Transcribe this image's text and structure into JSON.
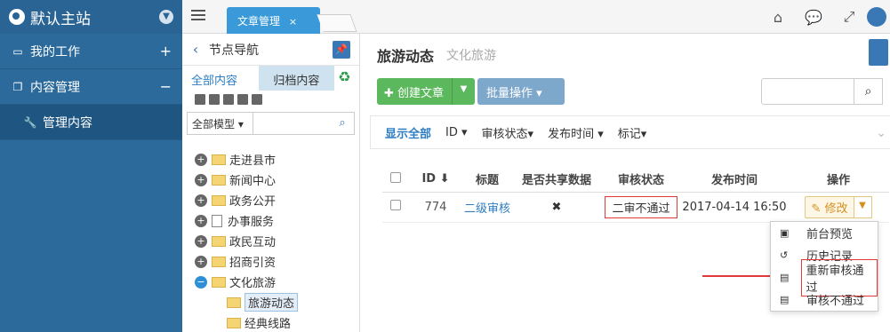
{
  "sidebar": {
    "brand": "默认主站",
    "items": [
      {
        "label": "我的工作",
        "toggle": "+"
      },
      {
        "label": "内容管理",
        "toggle": "−"
      },
      {
        "label": "管理内容"
      }
    ]
  },
  "topbar": {
    "tab_label": "文章管理",
    "tab_close": "×"
  },
  "nav": {
    "title": "节点导航",
    "tab_all": "全部内容",
    "tab_archive": "归档内容",
    "model_select": "全部模型 ▾",
    "tree": [
      {
        "label": "走进县市",
        "toggle": "+"
      },
      {
        "label": "新闻中心",
        "toggle": "+"
      },
      {
        "label": "政务公开",
        "toggle": "+"
      },
      {
        "label": "办事服务",
        "toggle": "+"
      },
      {
        "label": "政民互动",
        "toggle": "+"
      },
      {
        "label": "招商引资",
        "toggle": "+"
      },
      {
        "label": "文化旅游",
        "toggle": "−"
      },
      {
        "label": "旅游动态"
      },
      {
        "label": "经典线路"
      }
    ]
  },
  "main": {
    "title": "旅游动态",
    "subtitle": "文化旅游",
    "create_label": "✚ 创建文章",
    "batch_label": "批量操作 ▾",
    "filters": [
      "显示全部",
      "ID ▾",
      "审核状态▾",
      "发布时间 ▾",
      "标记▾"
    ],
    "table": {
      "headers": [
        "ID ⬇",
        "标题",
        "是否共享数据",
        "审核状态",
        "发布时间",
        "操作"
      ],
      "rows": [
        {
          "id": "774",
          "title": "二级审核",
          "shared": "✖",
          "status": "二审不通过",
          "time": "2017-04-14 16:50",
          "action": "✎ 修改"
        }
      ]
    },
    "dropdown": [
      "前台预览",
      "历史记录",
      "重新审核通过",
      "审核不通过"
    ]
  }
}
